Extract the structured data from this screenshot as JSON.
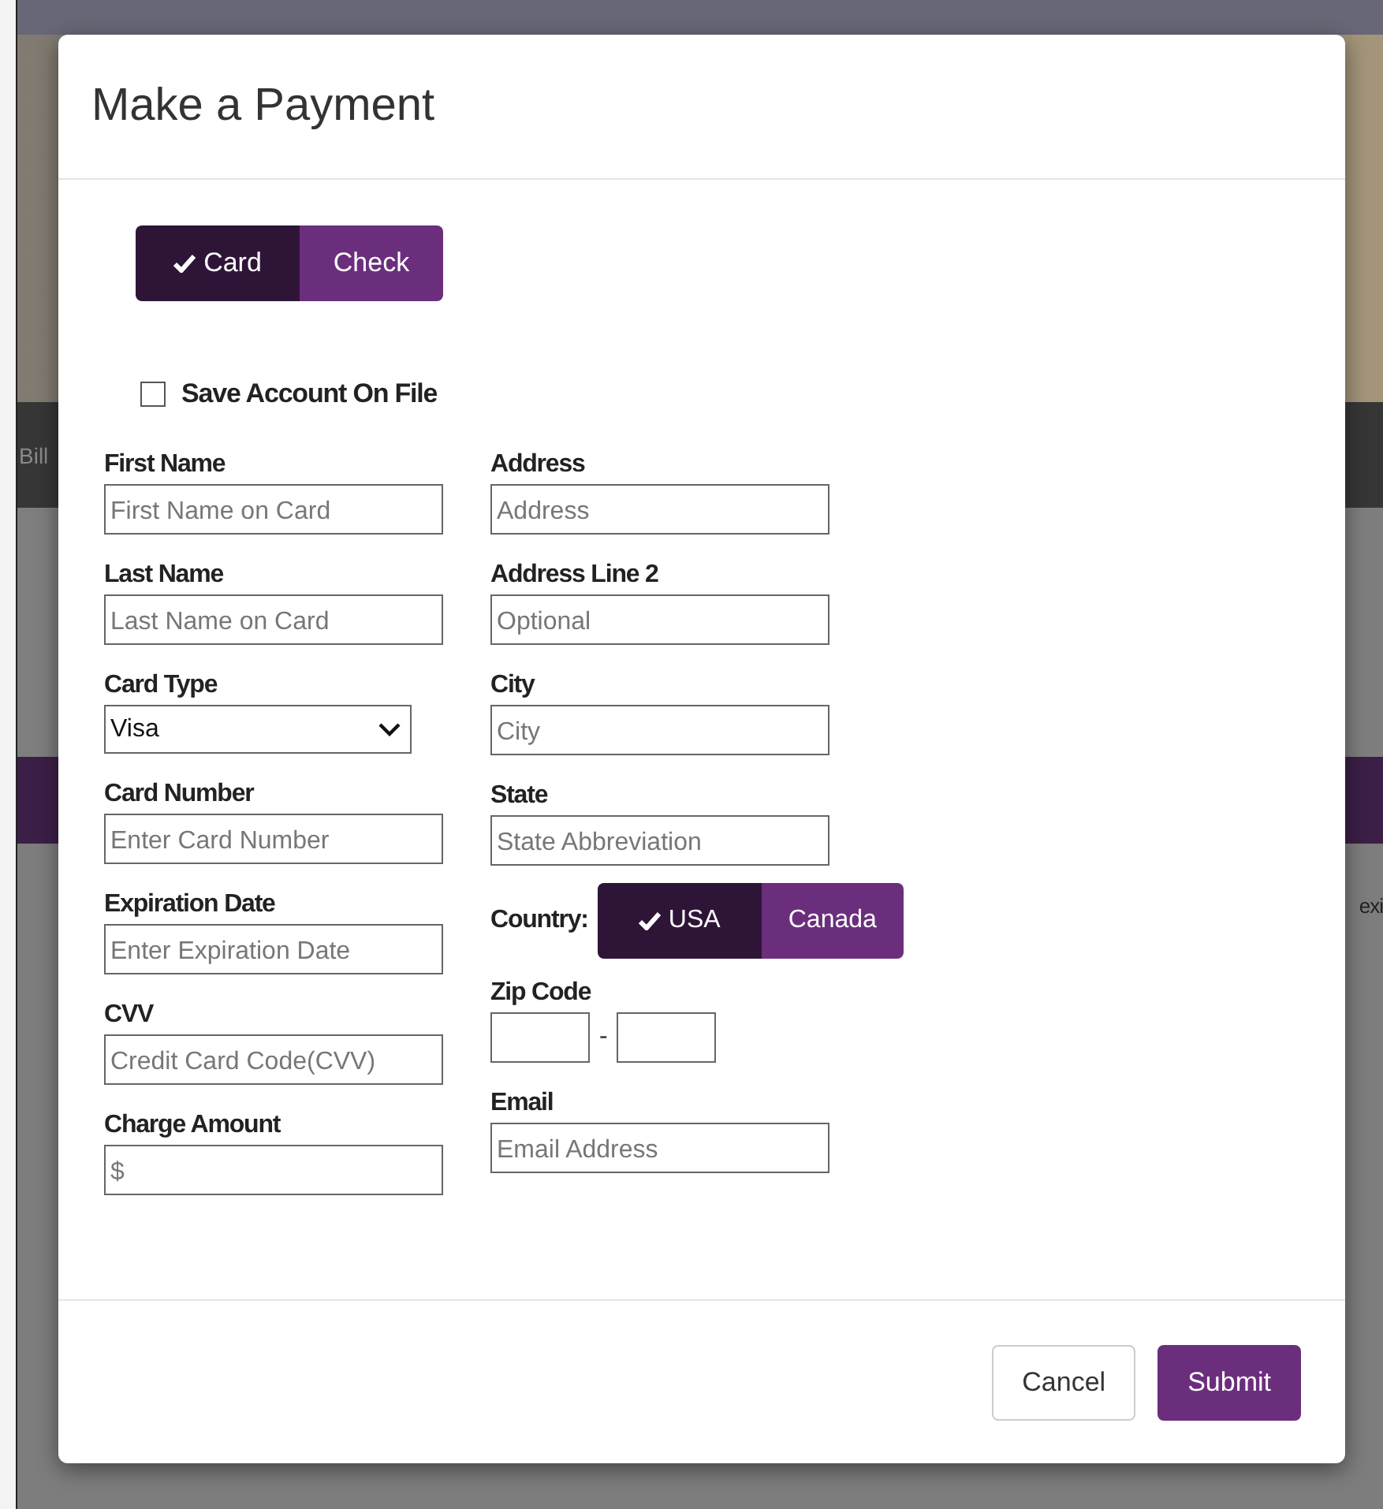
{
  "backdrop": {
    "fragments": [
      {
        "text": "Bill",
        "kind": "nav"
      },
      {
        "text": "exi",
        "kind": "side"
      }
    ]
  },
  "dialog": {
    "title": "Make a Payment",
    "payment_method": [
      {
        "label": "Card",
        "selected": true
      },
      {
        "label": "Check",
        "selected": false
      }
    ],
    "save_account": {
      "label": "Save Account On File",
      "checked": false
    },
    "left_fields": [
      {
        "kind": "text",
        "label": "First Name",
        "placeholder": "First Name on Card"
      },
      {
        "kind": "text",
        "label": "Last Name",
        "placeholder": "Last Name on Card"
      },
      {
        "kind": "select",
        "label": "Card Type",
        "value": "Visa"
      },
      {
        "kind": "text",
        "label": "Card Number",
        "placeholder": "Enter Card Number"
      },
      {
        "kind": "text",
        "label": "Expiration Date",
        "placeholder": "Enter Expiration Date"
      },
      {
        "kind": "text",
        "label": "CVV",
        "placeholder": "Credit Card Code(CVV)"
      },
      {
        "kind": "text",
        "label": "Charge Amount",
        "placeholder": "$"
      }
    ],
    "right_fields": [
      {
        "kind": "text",
        "label": "Address",
        "placeholder": "Address"
      },
      {
        "kind": "text",
        "label": "Address Line 2",
        "placeholder": "Optional"
      },
      {
        "kind": "text",
        "label": "City",
        "placeholder": "City"
      },
      {
        "kind": "text",
        "label": "State",
        "placeholder": "State Abbreviation"
      },
      {
        "kind": "toggle",
        "label": "Country:",
        "options": [
          {
            "label": "USA",
            "selected": true
          },
          {
            "label": "Canada",
            "selected": false
          }
        ]
      },
      {
        "kind": "zip",
        "label": "Zip Code",
        "separator": "-"
      },
      {
        "kind": "text",
        "label": "Email",
        "placeholder": "Email Address"
      }
    ],
    "buttons": [
      {
        "kind": "secondary",
        "label": "Cancel"
      },
      {
        "kind": "primary",
        "label": "Submit"
      }
    ]
  }
}
